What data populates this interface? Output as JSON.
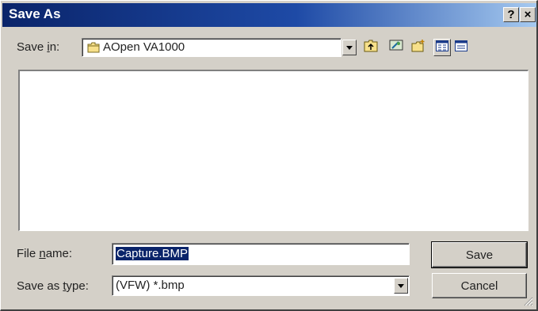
{
  "window": {
    "title": "Save As",
    "help_label": "?",
    "close_label": "×"
  },
  "save_in": {
    "label_pre": "Save ",
    "label_key": "i",
    "label_post": "n:",
    "value": "AOpen VA1000",
    "icon": "folder-icon"
  },
  "toolbar": {
    "buttons": [
      "up-one-level-icon",
      "desktop-icon",
      "new-folder-icon",
      "list-view-icon",
      "details-view-icon"
    ]
  },
  "file_name": {
    "label_pre": "File ",
    "label_key": "n",
    "label_post": "ame:",
    "value": "Capture.BMP"
  },
  "save_as_type": {
    "label_pre": "Save as ",
    "label_key": "t",
    "label_post": "ype:",
    "value": "(VFW) *.bmp"
  },
  "buttons": {
    "save_label": "Save",
    "cancel_label": "Cancel"
  },
  "colors": {
    "title_bar_start": "#0a246a",
    "title_bar_end": "#a6caf0",
    "selection": "#0a246a",
    "face": "#d4d0c8"
  }
}
